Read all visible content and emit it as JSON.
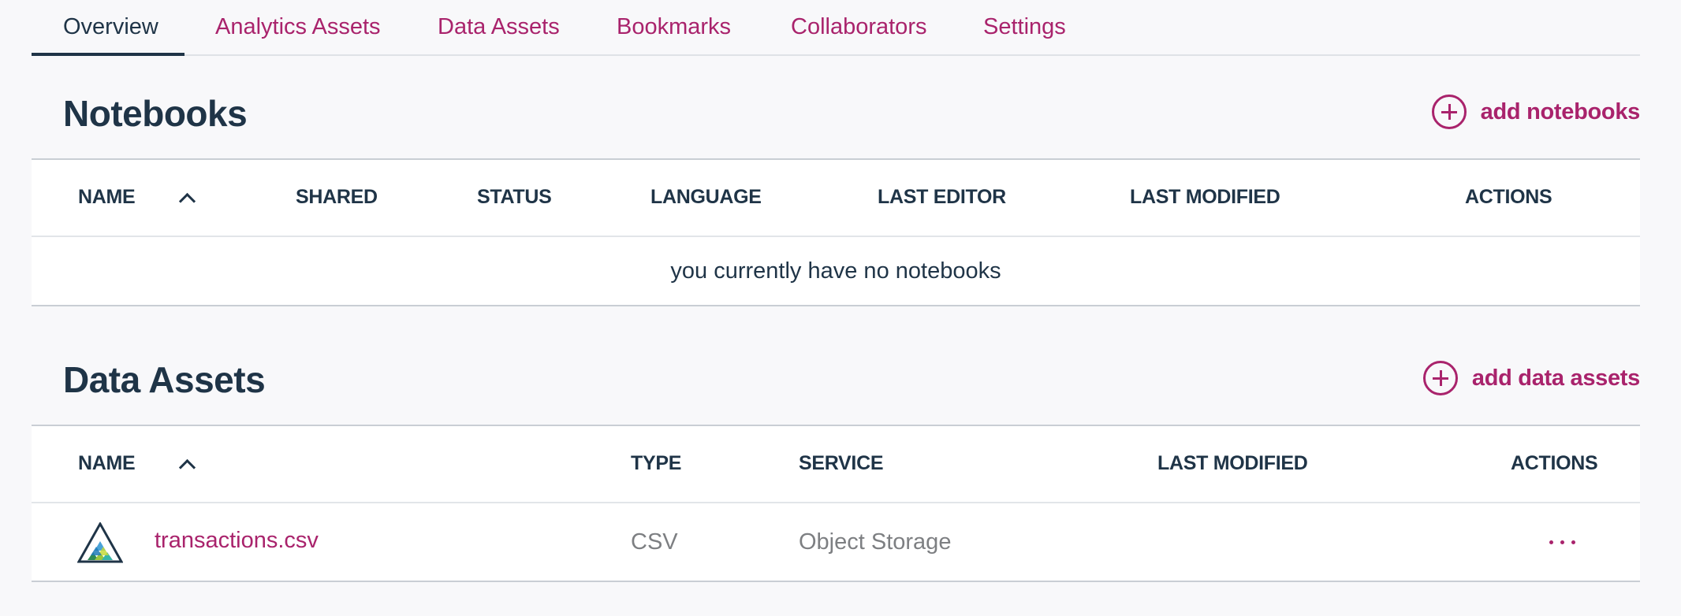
{
  "tabs": [
    {
      "label": "Overview",
      "active": true
    },
    {
      "label": "Analytics Assets"
    },
    {
      "label": "Data Assets"
    },
    {
      "label": "Bookmarks"
    },
    {
      "label": "Collaborators"
    },
    {
      "label": "Settings"
    }
  ],
  "notebooks": {
    "title": "Notebooks",
    "add_label": "add notebooks",
    "columns": [
      "NAME",
      "SHARED",
      "STATUS",
      "LANGUAGE",
      "LAST EDITOR",
      "LAST MODIFIED",
      "ACTIONS"
    ],
    "empty_message": "you currently have no notebooks"
  },
  "data_assets": {
    "title": "Data Assets",
    "add_label": "add data assets",
    "columns": [
      "NAME",
      "TYPE",
      "SERVICE",
      "LAST MODIFIED",
      "ACTIONS"
    ],
    "rows": [
      {
        "name": "transactions.csv",
        "type": "CSV",
        "service": "Object Storage",
        "last_modified": "",
        "icon": "csv-file-icon"
      }
    ]
  },
  "colors": {
    "accent": "#a9236c",
    "heading": "#1f3447",
    "muted": "#7d7f82",
    "background": "#f8f8fa"
  }
}
